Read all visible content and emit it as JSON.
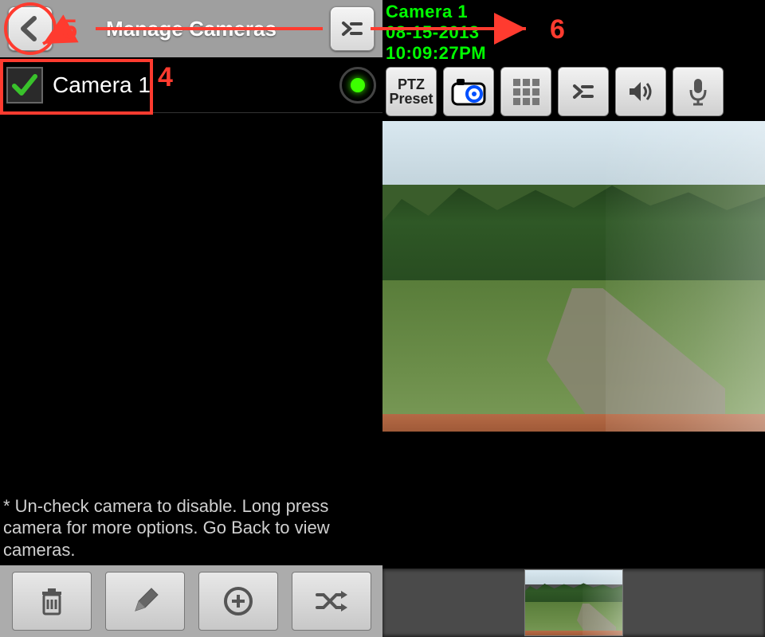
{
  "annotations": {
    "five": "5",
    "four": "4",
    "six": "6"
  },
  "left": {
    "title": "Manage Cameras",
    "camera_list": [
      {
        "label": "Camera 1",
        "checked": true,
        "recording": true
      }
    ],
    "instruction": "* Un-check camera to disable. Long press camera for more options. Go Back to view cameras.",
    "bottom_icons": {
      "delete": "delete-icon",
      "edit": "edit-icon",
      "add": "add-icon",
      "shuffle": "shuffle-icon"
    }
  },
  "right": {
    "status": {
      "camera": "Camera 1",
      "date": "08-15-2013",
      "time": "10:09:27PM"
    },
    "toolbar": {
      "ptz_line1": "PTZ",
      "ptz_line2": "Preset"
    },
    "tool_icons": {
      "ptz": "ptz-preset-button",
      "snapshot": "snapshot-camera-icon",
      "multiview": "grid-icon",
      "advanced": "advanced-menu-icon",
      "audio": "speaker-icon",
      "mic": "microphone-icon"
    }
  },
  "colors": {
    "status_text": "#00ff00",
    "annotation": "#ff3b2f"
  }
}
